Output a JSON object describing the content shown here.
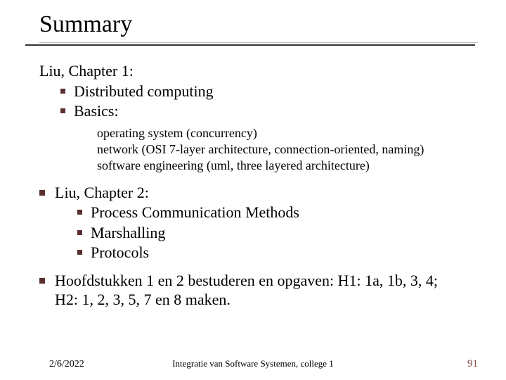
{
  "title": "Summary",
  "chapter1": {
    "heading": "Liu, Chapter 1:",
    "items": [
      "Distributed computing",
      "Basics:"
    ],
    "basics_sub": [
      "operating system (concurrency)",
      "network (OSI 7-layer architecture, connection-oriented, naming)",
      "software engineering (uml, three layered architecture)"
    ]
  },
  "chapter2": {
    "heading": "Liu, Chapter 2:",
    "items": [
      "Process Communication Methods",
      "Marshalling",
      "Protocols"
    ]
  },
  "assignment": "Hoofdstukken 1 en 2 bestuderen en opgaven: H1: 1a, 1b, 3, 4; H2: 1, 2, 3, 5, 7 en 8 maken.",
  "footer": {
    "date": "2/6/2022",
    "center": "Integratie van Software Systemen, college 1",
    "page": "91"
  }
}
